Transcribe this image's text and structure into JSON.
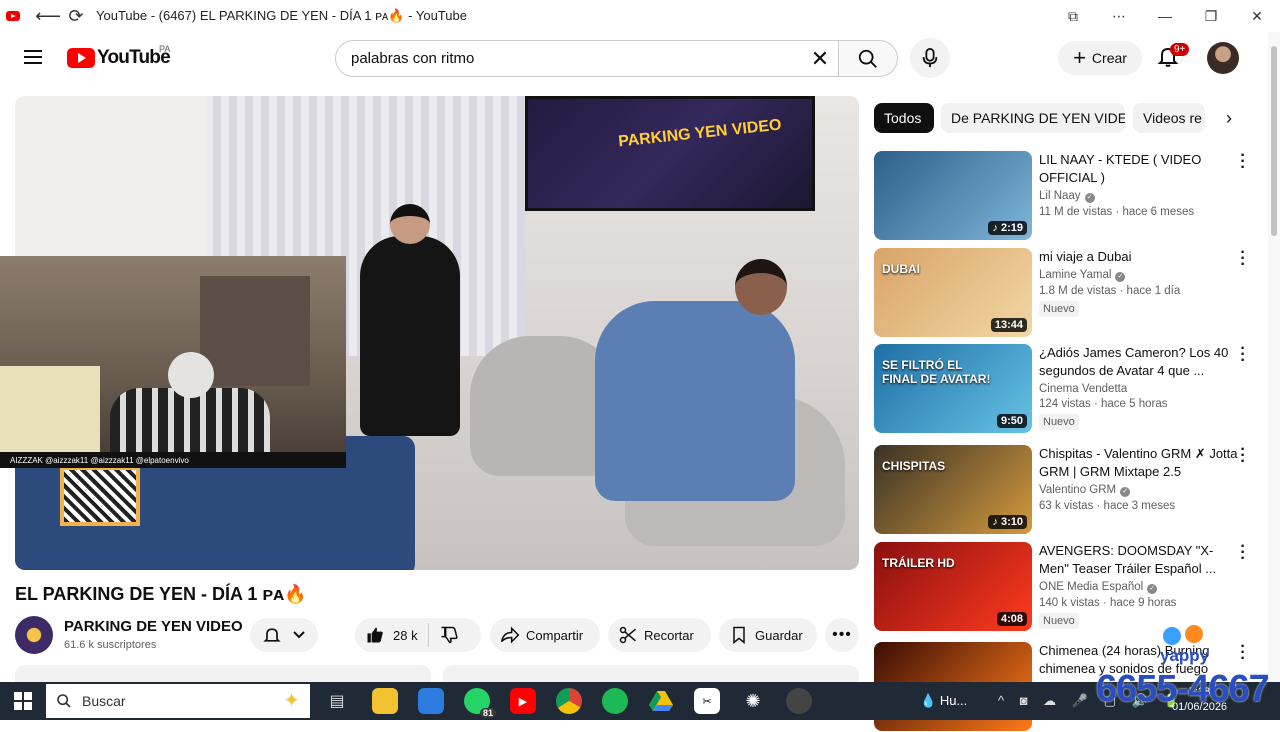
{
  "window": {
    "title": "YouTube - (6467) EL PARKING DE YEN - DÍA 1 ᴘᴀ🔥 - YouTube",
    "controls": [
      "⧉",
      "⋯",
      "—",
      "❐",
      "✕"
    ]
  },
  "header": {
    "logo_text": "YouTube",
    "country_code": "PA",
    "search_value": "palabras con ritmo",
    "create_label": "Crear",
    "notification_count": "9+"
  },
  "video": {
    "title": "EL PARKING DE YEN - DÍA 1 ᴘᴀ🔥",
    "channel_name": "PARKING DE YEN VIDEO",
    "subscribers": "61.6 k suscriptores",
    "likes": "28 k",
    "share_label": "Compartir",
    "clip_label": "Recortar",
    "save_label": "Guardar",
    "tv_text": "PARKING YEN VIDEO",
    "stream_strip": "AIZZZAK   @aizzzak11   @aizzzak11   @elpatoenvivo"
  },
  "chips": [
    "Todos",
    "De PARKING DE YEN VIDEO",
    "Videos re"
  ],
  "recommendations": [
    {
      "title": "LIL NAAY - KTEDE ( VIDEO OFFICIAL )",
      "channel": "Lil Naay",
      "verified": true,
      "meta": "11 M de vistas · hace 6 meses",
      "duration": "♪ 2:19",
      "is_new": false,
      "thumb_colors": [
        "#2d5f8a",
        "#7fb6d9"
      ]
    },
    {
      "title": "mi viaje a Dubai",
      "channel": "Lamine Yamal",
      "verified": true,
      "meta": "1.8 M de vistas · hace 1 día",
      "duration": "13:44",
      "is_new": true,
      "thumb_label": "DUBAI",
      "thumb_colors": [
        "#d9a468",
        "#f2d7a6"
      ]
    },
    {
      "title": "¿Adiós James Cameron? Los 40 segundos de Avatar 4 que ...",
      "channel": "Cinema Vendetta",
      "verified": false,
      "meta": "124 vistas · hace 5 horas",
      "duration": "9:50",
      "is_new": true,
      "thumb_label": "SE FILTRÓ EL FINAL DE AVATAR!",
      "thumb_colors": [
        "#1f6fa5",
        "#67c3e6"
      ]
    },
    {
      "title": "Chispitas - Valentino GRM ✗ Jotta GRM | GRM Mixtape 2.5",
      "channel": "Valentino GRM",
      "verified": true,
      "meta": "63 k vistas · hace 3 meses",
      "duration": "♪ 3:10",
      "is_new": false,
      "thumb_label": "CHISPITAS",
      "thumb_colors": [
        "#3a3225",
        "#d49a3e"
      ]
    },
    {
      "title": "AVENGERS: DOOMSDAY \"X-Men\" Teaser Tráiler Español ...",
      "channel": "ONE Media Español",
      "verified": true,
      "meta": "140 k vistas · hace 9 horas",
      "duration": "4:08",
      "is_new": true,
      "thumb_label": "TRÁILER HD",
      "thumb_colors": [
        "#8a0f0f",
        "#ff3b1f"
      ]
    },
    {
      "title": "Chimenea (24 horas) Burning chimenea y sonidos de fuego",
      "channel": "",
      "verified": false,
      "meta": "",
      "duration": "",
      "is_new": false,
      "thumb_colors": [
        "#3a0d05",
        "#ff7a1a"
      ]
    }
  ],
  "new_label": "Nuevo",
  "taskbar": {
    "search_placeholder": "Buscar",
    "whatsapp_badge": "81",
    "weather": "Hu...",
    "time": "7:28",
    "date": "01/06/2026"
  },
  "overlay": {
    "brand": "yappy",
    "number": "6655-4667"
  }
}
